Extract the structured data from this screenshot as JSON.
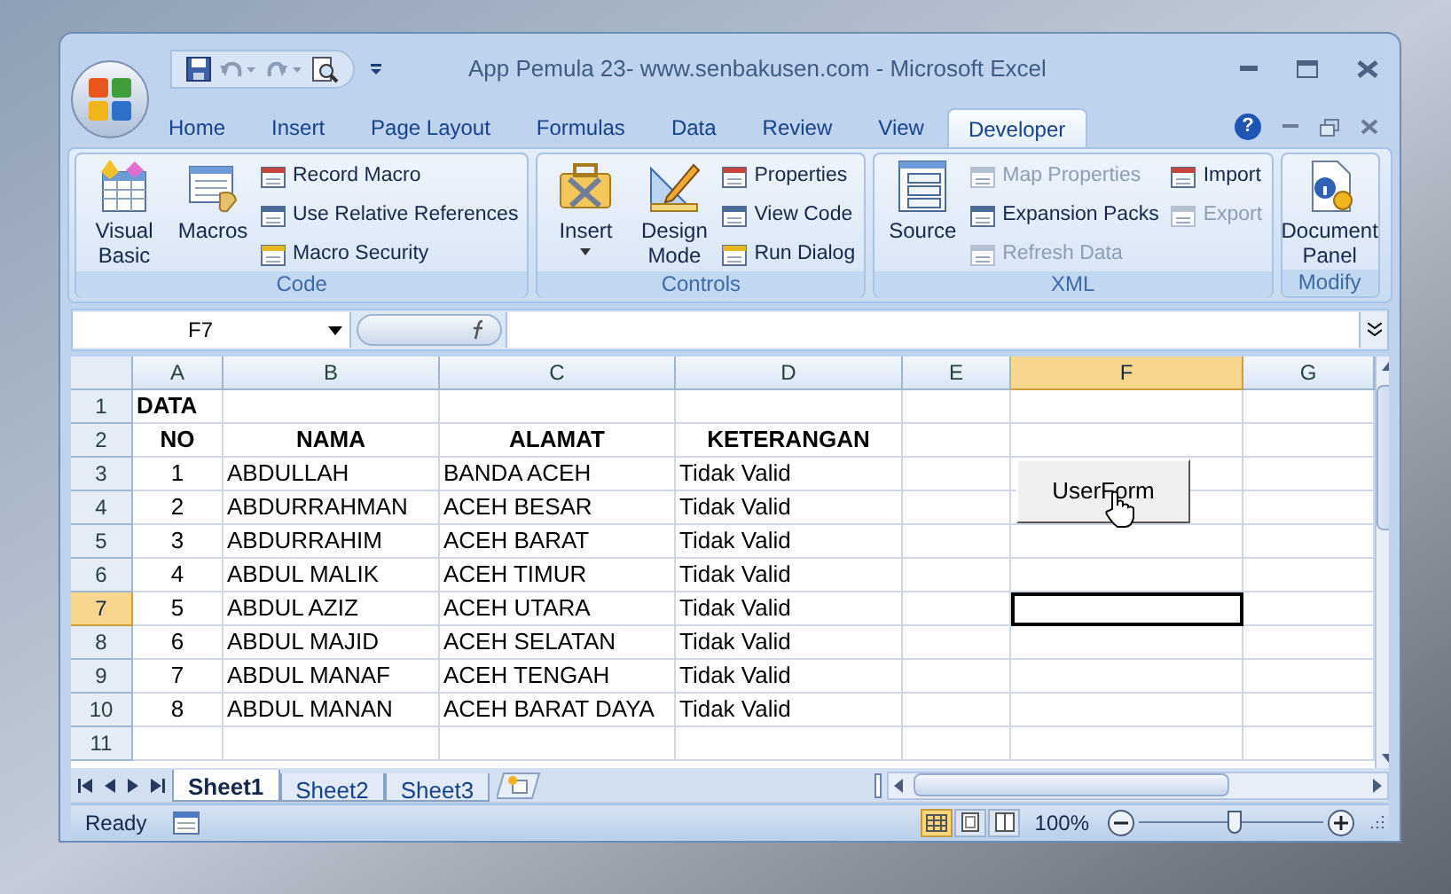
{
  "window": {
    "title": "App Pemula 23- www.senbakusen.com - Microsoft Excel"
  },
  "tabs": [
    {
      "label": "Home",
      "selected": false
    },
    {
      "label": "Insert",
      "selected": false
    },
    {
      "label": "Page Layout",
      "selected": false
    },
    {
      "label": "Formulas",
      "selected": false
    },
    {
      "label": "Data",
      "selected": false
    },
    {
      "label": "Review",
      "selected": false
    },
    {
      "label": "View",
      "selected": false
    },
    {
      "label": "Developer",
      "selected": true
    }
  ],
  "ribbon": [
    {
      "label": "Code",
      "large": [
        {
          "label": "Visual Basic",
          "menu": false
        },
        {
          "label": "Macros",
          "menu": false
        }
      ],
      "small": [
        {
          "label": "Record Macro",
          "disabled": false
        },
        {
          "label": "Use Relative References",
          "disabled": false
        },
        {
          "label": "Macro Security",
          "disabled": false
        }
      ]
    },
    {
      "label": "Controls",
      "large": [
        {
          "label": "Insert",
          "menu": true
        },
        {
          "label": "Design Mode",
          "menu": false
        }
      ],
      "small": [
        {
          "label": "Properties",
          "disabled": false
        },
        {
          "label": "View Code",
          "disabled": false
        },
        {
          "label": "Run Dialog",
          "disabled": false
        }
      ]
    },
    {
      "label": "XML",
      "large": [
        {
          "label": "Source",
          "menu": false
        }
      ],
      "small": [
        {
          "label": "Map Properties",
          "disabled": true
        },
        {
          "label": "Expansion Packs",
          "disabled": false
        },
        {
          "label": "Refresh Data",
          "disabled": true
        },
        {
          "label": "Import",
          "disabled": false
        },
        {
          "label": "Export",
          "disabled": true
        }
      ]
    },
    {
      "label": "Modify",
      "large": [
        {
          "label": "Document Panel",
          "menu": false
        }
      ]
    }
  ],
  "help_button": {
    "label": "?"
  },
  "name_box": "F7",
  "columns": [
    {
      "label": "A",
      "selected": false
    },
    {
      "label": "B",
      "selected": false
    },
    {
      "label": "C",
      "selected": false
    },
    {
      "label": "D",
      "selected": false
    },
    {
      "label": "E",
      "selected": false
    },
    {
      "label": "F",
      "selected": true
    },
    {
      "label": "G",
      "selected": false
    }
  ],
  "rows": [
    {
      "label": "1",
      "selected": false,
      "kind": "title",
      "cells": [
        "DATA"
      ]
    },
    {
      "label": "2",
      "selected": false,
      "kind": "header",
      "cells": [
        "NO",
        "NAMA",
        "ALAMAT",
        "KETERANGAN"
      ]
    },
    {
      "label": "3",
      "selected": false,
      "kind": "data",
      "cells": [
        "1",
        "ABDULLAH",
        "BANDA ACEH",
        "Tidak Valid"
      ]
    },
    {
      "label": "4",
      "selected": false,
      "kind": "data",
      "cells": [
        "2",
        "ABDURRAHMAN",
        "ACEH BESAR",
        "Tidak Valid"
      ]
    },
    {
      "label": "5",
      "selected": false,
      "kind": "data",
      "cells": [
        "3",
        "ABDURRAHIM",
        "ACEH BARAT",
        "Tidak Valid"
      ]
    },
    {
      "label": "6",
      "selected": false,
      "kind": "data",
      "cells": [
        "4",
        "ABDUL MALIK",
        "ACEH TIMUR",
        "Tidak Valid"
      ]
    },
    {
      "label": "7",
      "selected": true,
      "kind": "data",
      "cells": [
        "5",
        "ABDUL AZIZ",
        "ACEH UTARA",
        "Tidak Valid"
      ]
    },
    {
      "label": "8",
      "selected": false,
      "kind": "data",
      "cells": [
        "6",
        "ABDUL MAJID",
        "ACEH SELATAN",
        "Tidak Valid"
      ]
    },
    {
      "label": "9",
      "selected": false,
      "kind": "data",
      "cells": [
        "7",
        "ABDUL MANAF",
        "ACEH TENGAH",
        "Tidak Valid"
      ]
    },
    {
      "label": "10",
      "selected": false,
      "kind": "data",
      "cells": [
        "8",
        "ABDUL MANAN",
        "ACEH BARAT DAYA",
        "Tidak Valid"
      ]
    },
    {
      "label": "11",
      "selected": false,
      "kind": "blank",
      "cells": []
    }
  ],
  "form_button": {
    "label": "UserForm"
  },
  "sheets": [
    {
      "label": "Sheet1",
      "selected": true
    },
    {
      "label": "Sheet2",
      "selected": false
    },
    {
      "label": "Sheet3",
      "selected": false
    }
  ],
  "status_bar": {
    "status": "Ready",
    "zoom": "100%",
    "level": 0.52
  }
}
